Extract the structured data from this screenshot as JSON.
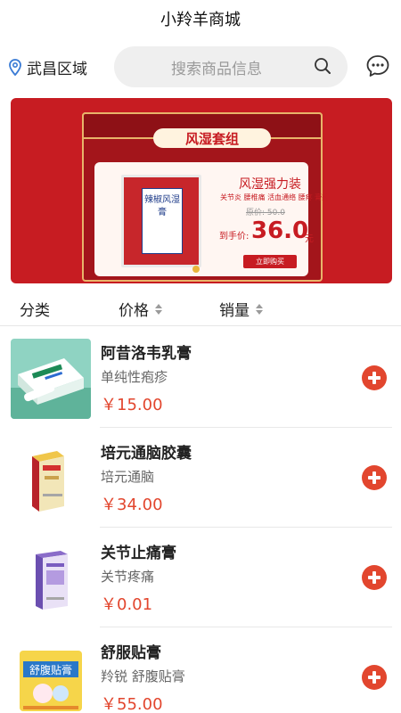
{
  "header": {
    "title": "小羚羊商城"
  },
  "location": {
    "label": "武昌区域",
    "icon": "location-pin-icon"
  },
  "search": {
    "placeholder": "搜索商品信息",
    "icon": "search-icon"
  },
  "message": {
    "icon": "chat-bubble-icon"
  },
  "banner": {
    "ribbon": "风湿套组",
    "package_text": "辣椒风湿膏",
    "promo_title": "风湿强力装",
    "promo_sub": "关节炎 腰椎痛 活血通络 腰疼 膏药",
    "original_price": "原价: 50.0",
    "price_label": "到手价:",
    "price": "36.0",
    "price_unit": "元",
    "buy_label": "立即购买",
    "colors": {
      "background": "#c71c22",
      "gold": "#e8b46a"
    }
  },
  "filters": [
    {
      "label": "分类",
      "sortable": false
    },
    {
      "label": "价格",
      "sortable": true
    },
    {
      "label": "销量",
      "sortable": true
    }
  ],
  "products": [
    {
      "name": "阿昔洛韦乳膏",
      "desc": "单纯性疱疹",
      "price": "￥15.00"
    },
    {
      "name": "培元通脑胶囊",
      "desc": "培元通脑",
      "price": "￥34.00"
    },
    {
      "name": "关节止痛膏",
      "desc": "关节疼痛",
      "price": "￥0.01"
    },
    {
      "name": "舒服贴膏",
      "desc": "羚锐 舒腹贴膏",
      "price": "￥55.00",
      "package_text": "舒腹贴膏"
    }
  ],
  "accent_color": "#e2462e"
}
